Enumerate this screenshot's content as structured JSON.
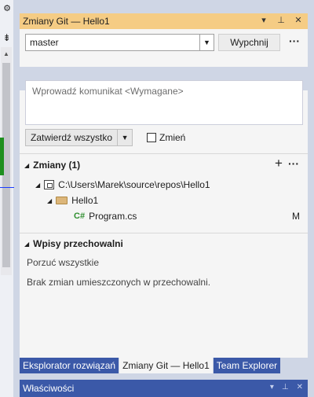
{
  "tool_window": {
    "title": "Zmiany Git — Hello1",
    "buttons": {
      "dropdown": "▾",
      "pin": "⊥",
      "close": "✕"
    }
  },
  "branch": {
    "selected": "master",
    "push_label": "Wypchnij",
    "more": "···"
  },
  "commit": {
    "placeholder": "Wprowadź komunikat <Wymagane>",
    "commit_all_label": "Zatwierdź wszystko",
    "amend_label": "Zmień"
  },
  "changes": {
    "header": "Zmiany (1)",
    "add": "+",
    "more": "···",
    "repo_path": "C:\\Users\\Marek\\source\\repos\\Hello1",
    "folder": "Hello1",
    "file": {
      "icon": "C#",
      "name": "Program.cs",
      "status": "M"
    }
  },
  "stash": {
    "header": "Wpisy przechowalni",
    "discard_all": "Porzuć wszystkie",
    "empty_message": "Brak zmian umieszczonych w przechowalni."
  },
  "tabs": [
    {
      "label": "Eksplorator rozwiązań"
    },
    {
      "label": "Zmiany Git — Hello1"
    },
    {
      "label": "Team Explorer"
    }
  ],
  "properties": {
    "title": "Właściwości",
    "buttons": {
      "dropdown": "▾",
      "pin": "⊥",
      "close": "✕"
    }
  },
  "colors": {
    "title_bar_active": "#f5cc84",
    "tab_inactive": "#3b59a8",
    "background": "#cfd6e5"
  }
}
